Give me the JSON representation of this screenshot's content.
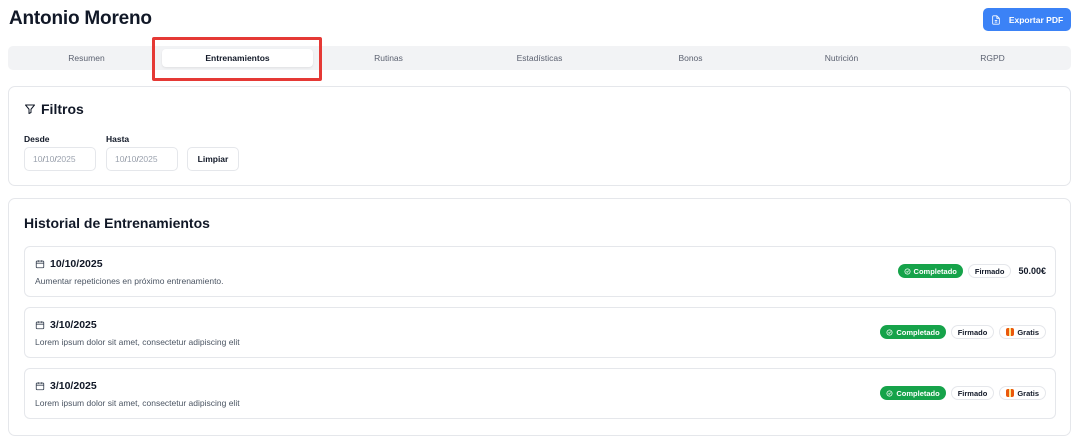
{
  "header": {
    "title": "Antonio Moreno",
    "export_label": "Exportar PDF"
  },
  "tabs": [
    {
      "label": "Resumen",
      "active": false
    },
    {
      "label": "Entrenamientos",
      "active": true
    },
    {
      "label": "Rutinas",
      "active": false
    },
    {
      "label": "Estadísticas",
      "active": false
    },
    {
      "label": "Bonos",
      "active": false
    },
    {
      "label": "Nutrición",
      "active": false
    },
    {
      "label": "RGPD",
      "active": false
    }
  ],
  "filters": {
    "title": "Filtros",
    "from_label": "Desde",
    "to_label": "Hasta",
    "from": {
      "day": "10",
      "month": "10",
      "year": "2025"
    },
    "to": {
      "day": "10",
      "month": "10",
      "year": "2025"
    },
    "clear_label": "Limpiar"
  },
  "history": {
    "title": "Historial de Entrenamientos",
    "sessions": [
      {
        "date": "10/10/2025",
        "note": "Aumentar repeticiones en próximo entrenamiento.",
        "status": "Completado",
        "signed": "Firmado",
        "price": "50.00€",
        "type": "paid"
      },
      {
        "date": "3/10/2025",
        "note": "Lorem ipsum dolor sit amet, consectetur adipiscing elit",
        "status": "Completado",
        "signed": "Firmado",
        "price": "Gratis",
        "type": "free"
      },
      {
        "date": "3/10/2025",
        "note": "Lorem ipsum dolor sit amet, consectetur adipiscing elit",
        "status": "Completado",
        "signed": "Firmado",
        "price": "Gratis",
        "type": "free"
      }
    ]
  },
  "colors": {
    "accent": "#3b82f6",
    "success": "#16a34a",
    "highlight": "#e53935"
  },
  "icons": {
    "export": "file-icon",
    "filters": "filter-icon",
    "date": "calendar-icon",
    "status": "check-circle-icon",
    "free": "gift-icon"
  }
}
